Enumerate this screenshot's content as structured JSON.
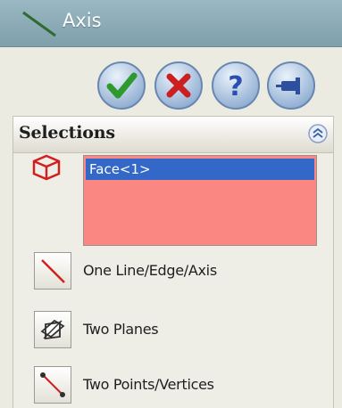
{
  "window": {
    "title": "Axis",
    "icon": "axis-icon"
  },
  "actions": [
    {
      "name": "ok-button",
      "icon": "checkmark-icon"
    },
    {
      "name": "cancel-button",
      "icon": "x-icon"
    },
    {
      "name": "help-button",
      "icon": "question-icon"
    },
    {
      "name": "pushpin-button",
      "icon": "pushpin-icon"
    }
  ],
  "selections": {
    "header": "Selections",
    "collapse_icon": "double-chevron-up-icon",
    "list_items": [
      "Face<1>"
    ],
    "list_background": "#fa8782",
    "selected_highlight": "#3468c8"
  },
  "options": [
    {
      "label": "One Line/Edge/Axis",
      "icon": "line-edge-axis-icon"
    },
    {
      "label": "Two Planes",
      "icon": "two-planes-icon"
    },
    {
      "label": "Two Points/Vertices",
      "icon": "two-points-icon"
    }
  ],
  "colors": {
    "titlebar": "#8eacb8",
    "panel_background": "#ecebe2",
    "accent_red": "#d02020"
  }
}
